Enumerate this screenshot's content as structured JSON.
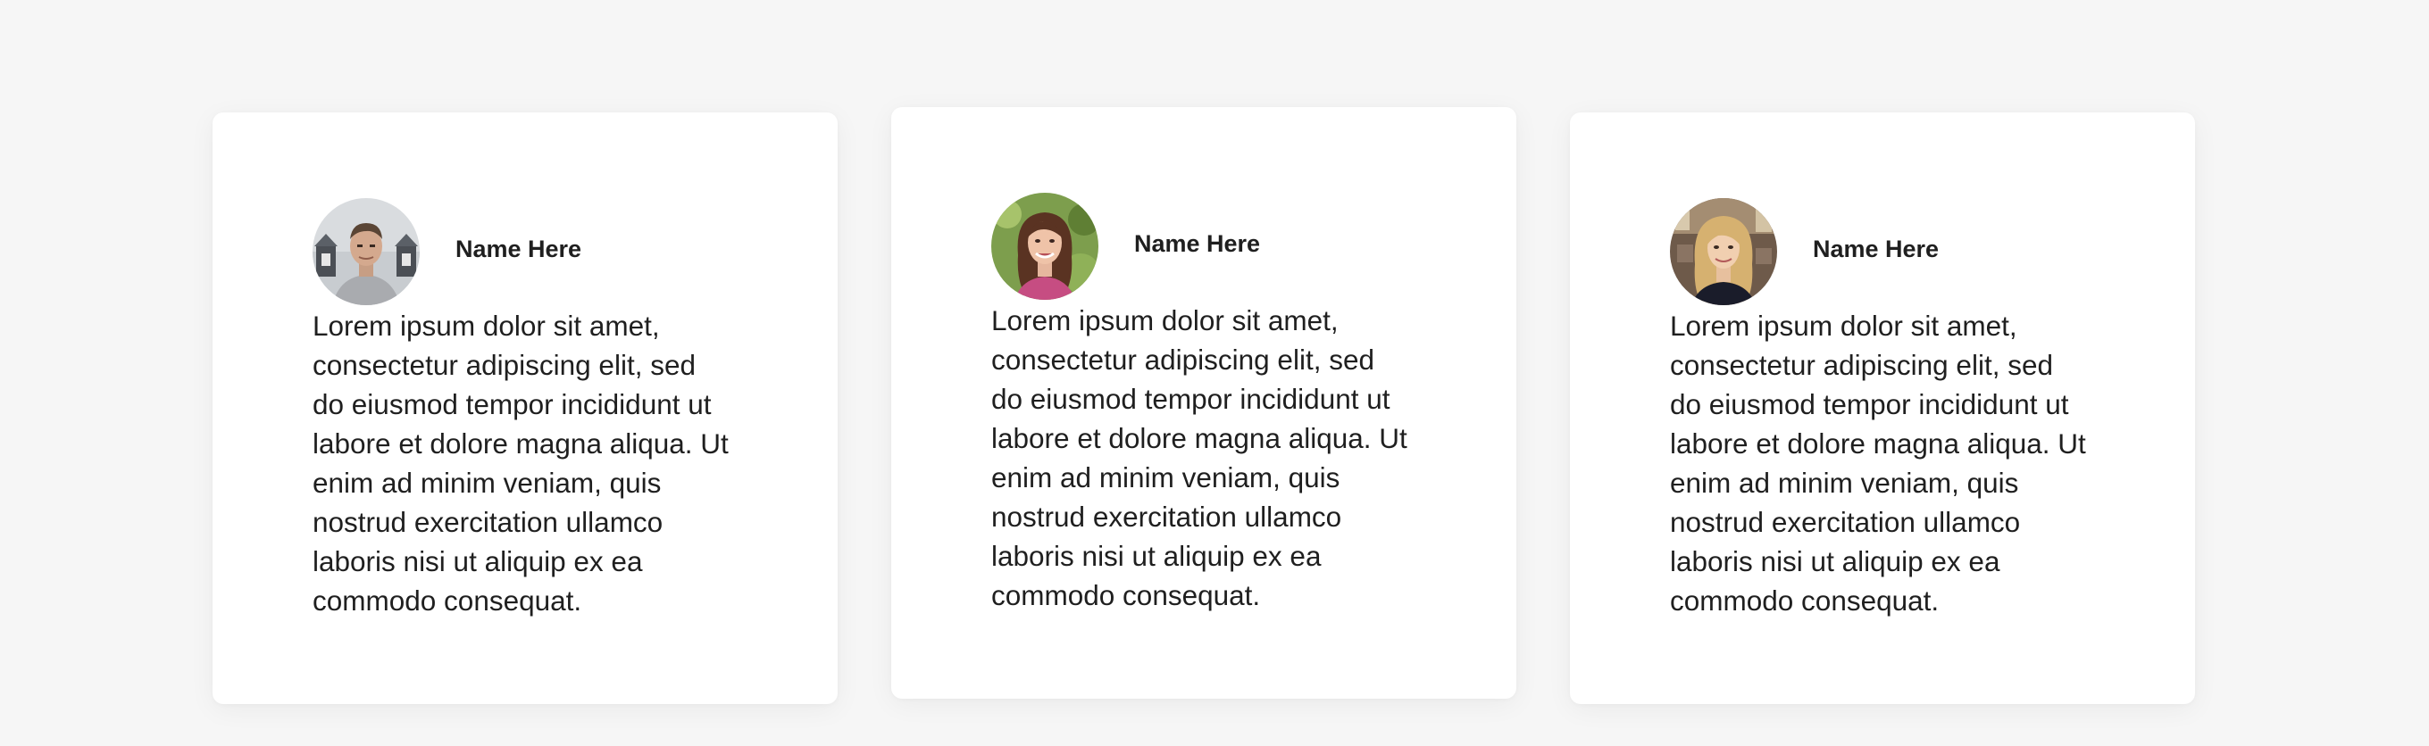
{
  "testimonials": [
    {
      "name": "Name Here",
      "text": "Lorem ipsum dolor sit amet,\nconsectetur adipiscing elit, sed\ndo eiusmod tempor incididunt ut\nlabore et dolore magna aliqua. Ut\nenim ad minim veniam, quis\nnostrud exercitation ullamco\nlaboris nisi ut aliquip ex ea\ncommodo consequat."
    },
    {
      "name": "Name Here",
      "text": "Lorem ipsum dolor sit amet,\nconsectetur adipiscing elit, sed\ndo eiusmod tempor incididunt ut\nlabore et dolore magna aliqua. Ut\nenim ad minim veniam, quis\nnostrud exercitation ullamco\nlaboris nisi ut aliquip ex ea\ncommodo consequat."
    },
    {
      "name": "Name Here",
      "text": "Lorem ipsum dolor sit amet,\nconsectetur adipiscing elit, sed\ndo eiusmod tempor incididunt ut\nlabore et dolore magna aliqua. Ut\nenim ad minim veniam, quis\nnostrud exercitation ullamco\nlaboris nisi ut aliquip ex ea\ncommodo consequat."
    }
  ]
}
